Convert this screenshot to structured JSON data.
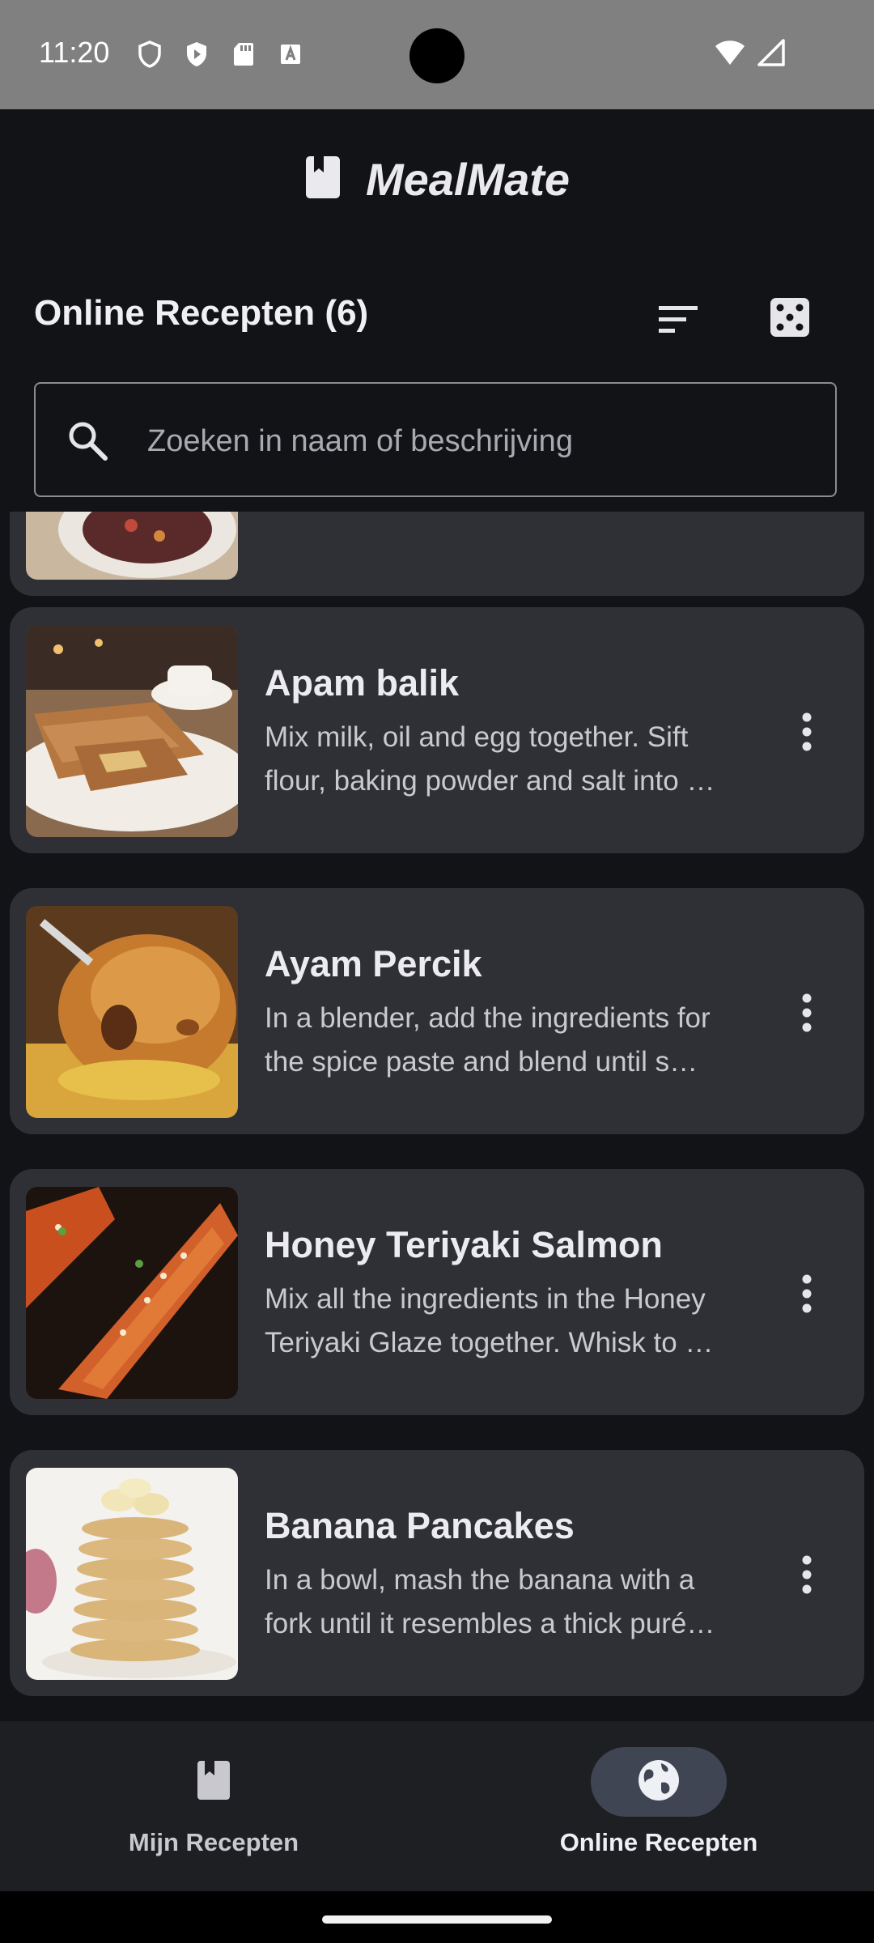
{
  "status_bar": {
    "time": "11:20",
    "icons": [
      "shield-icon",
      "play-protect-icon",
      "sd-card-icon",
      "keyboard-a-icon"
    ],
    "right_icons": [
      "wifi-icon",
      "signal-icon"
    ]
  },
  "header": {
    "app_name": "MealMate",
    "logo_icon": "book-icon"
  },
  "section": {
    "title": "Online Recepten (6)",
    "sort_icon": "sort-icon",
    "random_icon": "dice-icon"
  },
  "search": {
    "value": "",
    "placeholder": "Zoeken in naam of beschrijving"
  },
  "recipes": [
    {
      "title": "Apam balik",
      "desc_line1": "Mix milk, oil and egg together. Sift",
      "desc_line2": "flour, baking powder and salt into …"
    },
    {
      "title": "Ayam Percik",
      "desc_line1": "In a blender, add the ingredients for",
      "desc_line2": "the spice paste and blend until s…"
    },
    {
      "title": "Honey Teriyaki Salmon",
      "desc_line1": "Mix all the ingredients in the Honey",
      "desc_line2": "Teriyaki Glaze together. Whisk to …"
    },
    {
      "title": "Banana Pancakes",
      "desc_line1": "In a bowl, mash the banana with a",
      "desc_line2": "fork until it resembles a thick puré…"
    }
  ],
  "bottom_nav": {
    "items": [
      {
        "label": "Mijn Recepten",
        "icon": "book-icon",
        "active": false
      },
      {
        "label": "Online Recepten",
        "icon": "globe-icon",
        "active": true
      }
    ]
  },
  "colors": {
    "background": "#121317",
    "card": "#2f3035",
    "active_pill": "#3f4553"
  }
}
